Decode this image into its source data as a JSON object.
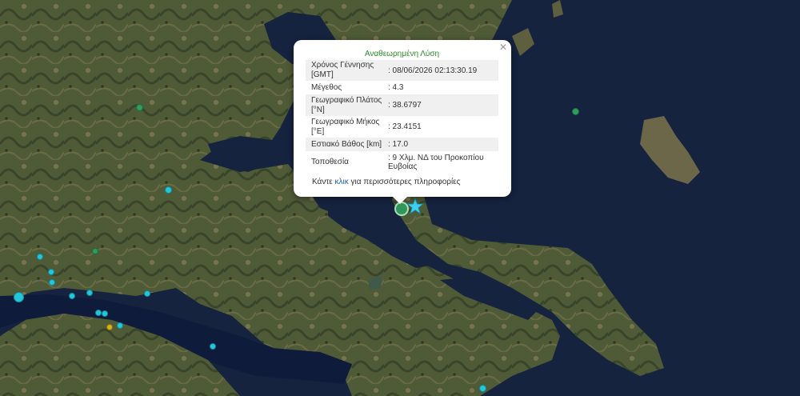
{
  "popup": {
    "title": "Αναθεωρημένη Λύση",
    "rows": [
      {
        "label": "Χρόνος Γέννησης [GMT]",
        "value": ": 08/06/2026 02:13:30.19"
      },
      {
        "label": "Μέγεθος",
        "value": ": 4.3"
      },
      {
        "label": "Γεωγραφικό Πλάτος [°N]",
        "value": ": 38.6797"
      },
      {
        "label": "Γεωγραφικό Μήκος [°E]",
        "value": ": 23.4151"
      },
      {
        "label": "Εστιακό Βάθος [km]",
        "value": ": 17.0"
      },
      {
        "label": "Τοποθεσία",
        "value": ": 9 Χλμ. ΝΔ του Προκοπίου Ευβοίας"
      }
    ],
    "more_before": "Κάντε ",
    "more_link": "κλικ",
    "more_after": " για περισσότερες πληροφορίες",
    "close_icon": "close-icon"
  },
  "colors": {
    "sea": "#16233f",
    "marker_cyan": "#26c6da",
    "marker_green": "#2e9e5e",
    "marker_yellow": "#d4b21e",
    "star": "#3fd0f0",
    "title_green": "#2c8a2c",
    "link_blue": "#1a5fb4"
  },
  "icons": {
    "epicenter": "star-icon",
    "event": "circle-marker"
  }
}
